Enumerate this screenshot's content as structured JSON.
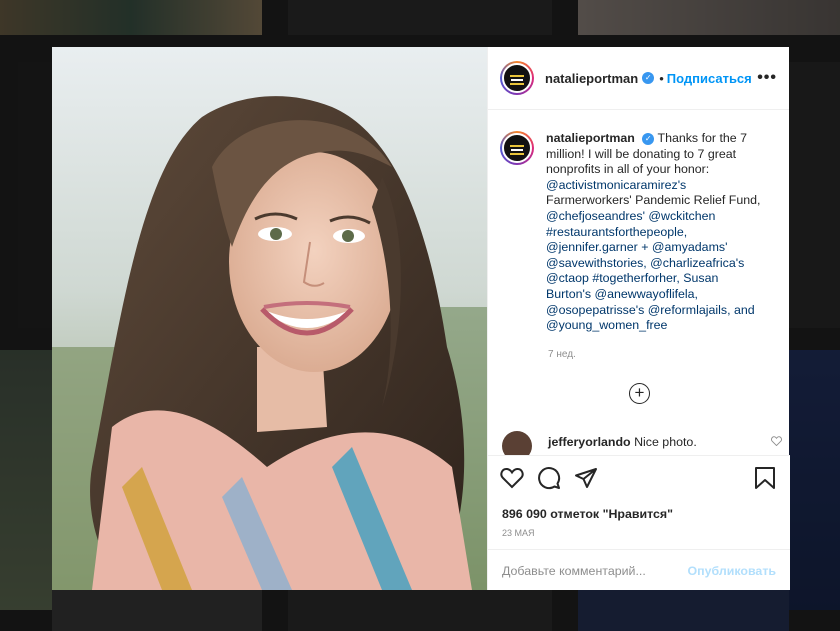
{
  "post": {
    "author": "natalieportman",
    "verified_mark": "✓",
    "dot": "•",
    "follow_label": "Подписаться",
    "more_label": "•••",
    "caption_lines": [
      {
        "type": "text",
        "value": "Thanks for the 7"
      },
      {
        "type": "text",
        "value": "million! I will be donating to 7 great"
      },
      {
        "type": "text",
        "value": "nonprofits in all of your honor:"
      },
      {
        "type": "link",
        "value": "@activistmonicaramirez's"
      },
      {
        "type": "text",
        "value": "Farmerworkers' Pandemic Relief Fund,"
      },
      {
        "type": "link",
        "value": "@chefjoseandres' @wckitchen"
      },
      {
        "type": "link",
        "value": "#restaurantsforthepeople,"
      },
      {
        "type": "link",
        "value": "@jennifer.garner + @amyadams'"
      },
      {
        "type": "link",
        "value": "@savewithstories, @charlizeafrica's"
      },
      {
        "type": "link",
        "value": "@ctaop #togetherforher, Susan"
      },
      {
        "type": "link",
        "value": "Burton's @anewwayoflifela,"
      },
      {
        "type": "link",
        "value": "@osopepatrisse's @reformlajails, and"
      },
      {
        "type": "link",
        "value": "@young_women_free"
      }
    ],
    "time_ago": "7 нед.",
    "load_more_symbol": "+",
    "comment": {
      "user": "jefferyorlando",
      "text": "Nice photo.",
      "heart_icon": "heart-outline-icon"
    },
    "likes_text": "896 090 отметок \"Нравится\"",
    "date_text": "23 мая",
    "comment_placeholder": "Добавьте комментарий...",
    "publish_label": "Опубликовать"
  },
  "colors": {
    "accent": "#0095f6",
    "link": "#00376b",
    "muted": "#8e8e8e",
    "publish_disabled": "#b2dffc"
  },
  "icons": [
    "heart-icon",
    "comment-icon",
    "share-icon",
    "bookmark-icon",
    "plus-circle-icon",
    "verified-icon",
    "more-icon"
  ]
}
